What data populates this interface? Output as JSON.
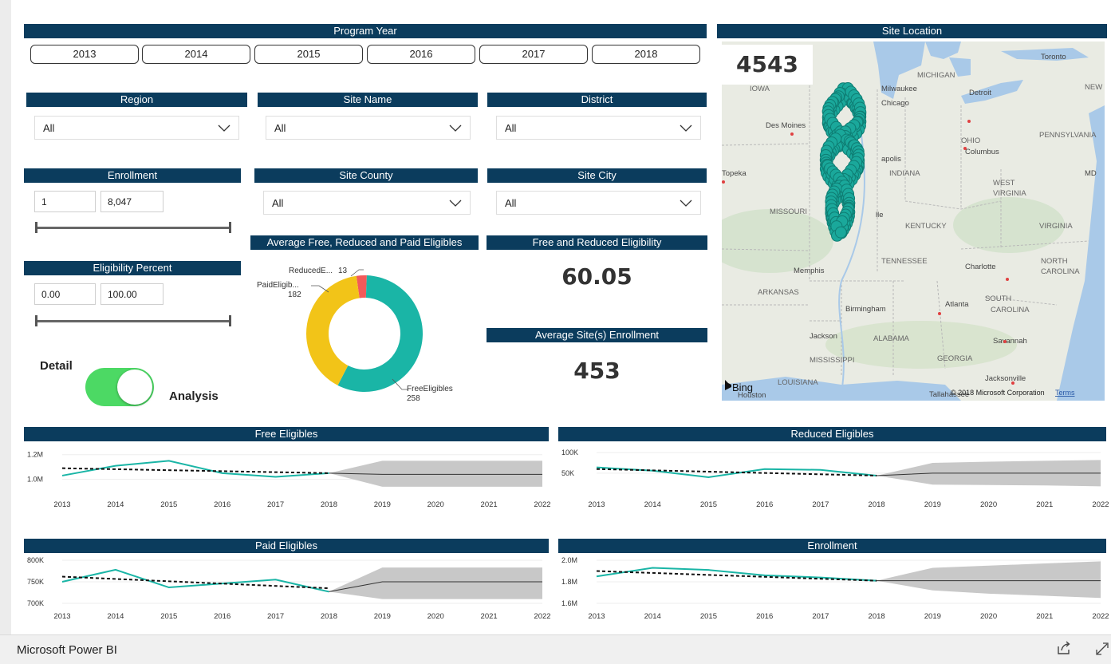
{
  "filters": {
    "program_year": {
      "title": "Program Year",
      "years": [
        "2013",
        "2014",
        "2015",
        "2016",
        "2017",
        "2018"
      ]
    },
    "region": {
      "title": "Region",
      "value": "All"
    },
    "site_name": {
      "title": "Site Name",
      "value": "All"
    },
    "district": {
      "title": "District",
      "value": "All"
    },
    "site_county": {
      "title": "Site County",
      "value": "All"
    },
    "site_city": {
      "title": "Site City",
      "value": "All"
    },
    "enrollment": {
      "title": "Enrollment",
      "min": "1",
      "max": "8,047"
    },
    "eligibility_percent": {
      "title": "Eligibility Percent",
      "min": "0.00",
      "max": "100.00"
    }
  },
  "toggle": {
    "left_label": "Detail",
    "right_label": "Analysis",
    "state": "on"
  },
  "kpis": {
    "free_reduced": {
      "title": "Free and Reduced Eligibility",
      "value": "60.05"
    },
    "avg_enrollment": {
      "title": "Average Site(s) Enrollment",
      "value": "453"
    }
  },
  "map": {
    "title": "Site Location",
    "count": "4543",
    "labels": [
      "Toronto",
      "MICHIGAN",
      "IOWA",
      "Milwaukee",
      "Chicago",
      "Detroit",
      "NEW YC",
      "Des Moines",
      "OHIO",
      "Columbus",
      "PENNSYLVANIA",
      "apolis",
      "INDIANA",
      "Topeka",
      "WEST",
      "VIRGINIA",
      "MD",
      "MISSOURI",
      "lle",
      "KENTUCKY",
      "VIRGINIA",
      "TENNESSEE",
      "Memphis",
      "Charlotte",
      "NORTH",
      "CAROLINA",
      "ARKANSAS",
      "Birmingham",
      "Atlanta",
      "SOUTH",
      "CAROLINA",
      "Jackson",
      "ALABAMA",
      "Savannah",
      "MISSISSIPPI",
      "GEORGIA",
      "LOUISIANA",
      "Houston",
      "Jacksonville",
      "Tallahassee"
    ],
    "bing_label": "Bing",
    "copyright": "© 2018 Microsoft Corporation",
    "terms": "Terms"
  },
  "footer": {
    "brand": "Microsoft Power BI",
    "share_icon": "share-icon",
    "expand_icon": "expand-icon"
  },
  "colors": {
    "header": "#0b3c5d",
    "teal": "#1ab5a6",
    "yellow": "#f2c418",
    "red": "#f25a5a",
    "toggle_on": "#4cd964"
  },
  "chart_data": [
    {
      "type": "pie",
      "title": "Average Free, Reduced and Paid Eligibles",
      "labels": [
        "FreeEligibles",
        "PaidEligib...",
        "ReducedE..."
      ],
      "values": [
        258,
        182,
        13
      ],
      "colors": [
        "#1ab5a6",
        "#f2c418",
        "#f25a5a"
      ]
    },
    {
      "type": "line",
      "title": "Free Eligibles",
      "x": [
        "2013",
        "2014",
        "2015",
        "2016",
        "2017",
        "2018",
        "2019",
        "2020",
        "2021",
        "2022"
      ],
      "yticks": [
        "1.2M",
        "1.0M"
      ],
      "ylim": [
        900000,
        1250000
      ],
      "actual": [
        1030000,
        1110000,
        1150000,
        1050000,
        1020000,
        1050000
      ],
      "trend": [
        1090000,
        1050000
      ],
      "forecast": [
        1050000,
        1040000,
        1040000,
        1040000,
        1040000
      ],
      "forecast_upper": [
        1050000,
        1150000,
        1150000,
        1150000,
        1150000
      ],
      "forecast_lower": [
        1050000,
        940000,
        940000,
        940000,
        940000
      ]
    },
    {
      "type": "line",
      "title": "Reduced Eligibles",
      "x": [
        "2013",
        "2014",
        "2015",
        "2016",
        "2017",
        "2018",
        "2019",
        "2020",
        "2021",
        "2022"
      ],
      "yticks": [
        "100K",
        "50K"
      ],
      "ylim": [
        5000,
        110000
      ],
      "actual": [
        64000,
        56000,
        40000,
        60000,
        58000,
        44000
      ],
      "trend": [
        60000,
        44000
      ],
      "forecast": [
        44000,
        50000,
        50000,
        50000,
        50000
      ],
      "forecast_upper": [
        44000,
        75000,
        78000,
        80000,
        82000
      ],
      "forecast_lower": [
        44000,
        22000,
        21000,
        20000,
        18000
      ]
    },
    {
      "type": "line",
      "title": "Paid Eligibles",
      "x": [
        "2013",
        "2014",
        "2015",
        "2016",
        "2017",
        "2018",
        "2019",
        "2020",
        "2021",
        "2022"
      ],
      "yticks": [
        "800K",
        "750K",
        "700K"
      ],
      "ylim": [
        700000,
        800000
      ],
      "actual": [
        750000,
        778000,
        737000,
        746000,
        755000,
        727000
      ],
      "trend": [
        762000,
        735000
      ],
      "forecast": [
        727000,
        750000,
        750000,
        750000,
        750000
      ],
      "forecast_upper": [
        727000,
        783000,
        783000,
        783000,
        783000
      ],
      "forecast_lower": [
        727000,
        710000,
        710000,
        710000,
        710000
      ]
    },
    {
      "type": "line",
      "title": "Enrollment",
      "x": [
        "2013",
        "2014",
        "2015",
        "2016",
        "2017",
        "2018",
        "2019",
        "2020",
        "2021",
        "2022"
      ],
      "yticks": [
        "2.0M",
        "1.8M",
        "1.6M"
      ],
      "ylim": [
        1600000,
        2000000
      ],
      "actual": [
        1850000,
        1930000,
        1910000,
        1860000,
        1840000,
        1810000
      ],
      "trend": [
        1900000,
        1810000
      ],
      "forecast": [
        1810000,
        1810000,
        1810000,
        1810000,
        1810000
      ],
      "forecast_upper": [
        1810000,
        1930000,
        1950000,
        1970000,
        1990000
      ],
      "forecast_lower": [
        1810000,
        1720000,
        1690000,
        1670000,
        1650000
      ]
    }
  ]
}
